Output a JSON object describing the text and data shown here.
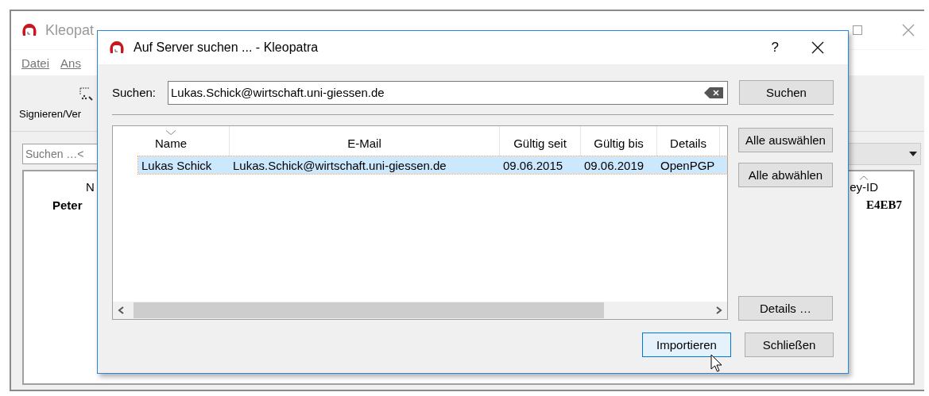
{
  "main_window": {
    "title": "Kleopat",
    "menu": [
      "Datei",
      "Ans"
    ],
    "toolbar": [
      "Signieren/Ver"
    ],
    "search": {
      "placeholder": "Suchen …<"
    },
    "table": {
      "columns": [
        "N",
        "ey-ID"
      ],
      "rows": [
        [
          "Peter",
          "E4EB7"
        ]
      ]
    }
  },
  "dialog": {
    "title": "Auf Server suchen ... - Kleopatra",
    "help": "?",
    "search": {
      "label": "Suchen:",
      "value": "Lukas.Schick@wirtschaft.uni-giessen.de",
      "button": "Suchen"
    },
    "table": {
      "columns": [
        "Name",
        "E-Mail",
        "Gültig seit",
        "Gültig bis",
        "Details"
      ],
      "rows": [
        {
          "cells": [
            "Lukas Schick",
            "Lukas.Schick@wirtschaft.uni-giessen.de",
            "09.06.2015",
            "09.06.2019",
            "OpenPGP"
          ],
          "selected": true
        }
      ]
    },
    "side_buttons": [
      "Alle auswählen",
      "Alle abwählen",
      "Details …"
    ],
    "buttons": [
      {
        "label": "Importieren",
        "hovered": true
      },
      {
        "label": "Schließen",
        "hovered": false
      }
    ]
  }
}
